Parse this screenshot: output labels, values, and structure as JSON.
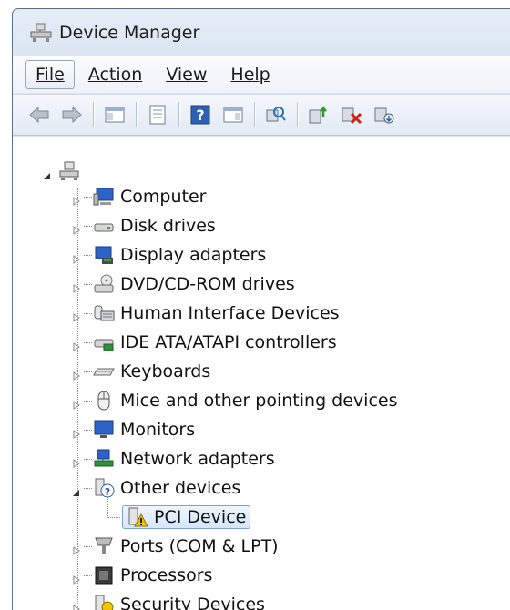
{
  "window": {
    "title": "Device Manager"
  },
  "menu": [
    {
      "label": "File",
      "mnemonic_index": 0
    },
    {
      "label": "Action",
      "mnemonic_index": 0
    },
    {
      "label": "View",
      "mnemonic_index": 0
    },
    {
      "label": "Help",
      "mnemonic_index": 0
    }
  ],
  "toolbar": {
    "buttons": [
      "back-arrow-icon",
      "forward-arrow-icon",
      "show-hide-console-tree-icon",
      "properties-icon",
      "help-icon",
      "action-pane-icon",
      "scan-hardware-icon",
      "update-driver-icon",
      "uninstall-icon",
      "disable-device-icon"
    ]
  },
  "tree": {
    "root": {
      "label": "",
      "icon": "computer-network-icon",
      "expanded": true
    },
    "items": [
      {
        "label": "Computer",
        "icon": "computer-icon",
        "expanded": false
      },
      {
        "label": "Disk drives",
        "icon": "disk-drive-icon",
        "expanded": false
      },
      {
        "label": "Display adapters",
        "icon": "display-adapter-icon",
        "expanded": false
      },
      {
        "label": "DVD/CD-ROM drives",
        "icon": "dvd-drive-icon",
        "expanded": false
      },
      {
        "label": "Human Interface Devices",
        "icon": "hid-icon",
        "expanded": false
      },
      {
        "label": "IDE ATA/ATAPI controllers",
        "icon": "ide-controller-icon",
        "expanded": false
      },
      {
        "label": "Keyboards",
        "icon": "keyboard-icon",
        "expanded": false
      },
      {
        "label": "Mice and other pointing devices",
        "icon": "mouse-icon",
        "expanded": false
      },
      {
        "label": "Monitors",
        "icon": "monitor-icon",
        "expanded": false
      },
      {
        "label": "Network adapters",
        "icon": "network-adapter-icon",
        "expanded": false
      },
      {
        "label": "Other devices",
        "icon": "unknown-device-icon",
        "expanded": true,
        "children": [
          {
            "label": "PCI Device",
            "icon": "warning-device-icon",
            "selected": true
          }
        ]
      },
      {
        "label": "Ports (COM & LPT)",
        "icon": "port-icon",
        "expanded": false
      },
      {
        "label": "Processors",
        "icon": "processor-icon",
        "expanded": false
      },
      {
        "label": "Security Devices",
        "icon": "security-device-icon",
        "expanded": false
      }
    ]
  },
  "colors": {
    "selection_border": "#7da2ce",
    "selection_fill": "#d6e7fb",
    "window_frame": "#dbe6f2"
  }
}
